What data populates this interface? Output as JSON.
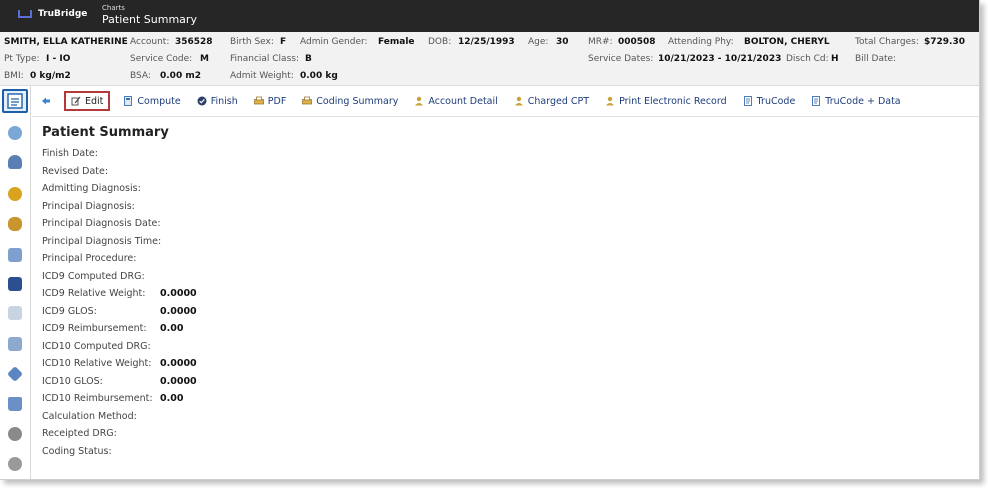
{
  "app": {
    "brand": "TruBridge",
    "breadcrumb_small": "Charts",
    "page_heading": "Patient Summary"
  },
  "patient": {
    "name": "SMITH, ELLA KATHERINE",
    "account_label": "Account:",
    "account": "356528",
    "birth_sex_label": "Birth Sex:",
    "birth_sex": "F",
    "admin_gender_label": "Admin Gender:",
    "admin_gender": "Female",
    "dob_label": "DOB:",
    "dob": "12/25/1993",
    "age_label": "Age:",
    "age": "30",
    "mrn_label": "MR#:",
    "mrn": "000508",
    "attending_label": "Attending Phy:",
    "attending": "BOLTON, CHERYL",
    "total_charges_label": "Total Charges:",
    "total_charges": "$729.30",
    "pt_type_label": "Pt Type:",
    "pt_type": "I - IO",
    "service_code_label": "Service Code:",
    "service_code": "M",
    "financial_class_label": "Financial Class:",
    "financial_class": "B",
    "service_dates_label": "Service Dates:",
    "service_dates": "10/21/2023 - 10/21/2023",
    "disch_cd_label": "Disch Cd:",
    "disch_cd": "H",
    "bill_date_label": "Bill Date:",
    "bill_date": "",
    "bmi_label": "BMI:",
    "bmi": "0 kg/m2",
    "bsa_label": "BSA:",
    "bsa": "0.00 m2",
    "admit_weight_label": "Admit Weight:",
    "admit_weight": "0.00 kg"
  },
  "sidebar": {
    "icons": [
      "charts-icon",
      "cloud-icon",
      "person-icon",
      "clock-icon",
      "people-icon",
      "document-icon",
      "book-icon",
      "note-icon",
      "file-icon",
      "tag-icon",
      "home-icon",
      "globe-icon",
      "settings-icon"
    ]
  },
  "toolbar": {
    "back": "",
    "edit": "Edit",
    "compute": "Compute",
    "finish": "Finish",
    "pdf": "PDF",
    "coding_summary": "Coding Summary",
    "account_detail": "Account Detail",
    "charged_cpt": "Charged CPT",
    "print_record": "Print Electronic Record",
    "trucode": "TruCode",
    "trucode_data": "TruCode + Data"
  },
  "summary": {
    "title": "Patient Summary",
    "fields": [
      {
        "label": "Finish Date:",
        "value": ""
      },
      {
        "label": "Revised Date:",
        "value": ""
      },
      {
        "label": "Admitting Diagnosis:",
        "value": ""
      },
      {
        "label": "Principal Diagnosis:",
        "value": ""
      },
      {
        "label": "Principal Diagnosis Date:",
        "value": ""
      },
      {
        "label": "Principal Diagnosis Time:",
        "value": ""
      },
      {
        "label": "Principal Procedure:",
        "value": ""
      },
      {
        "label": "ICD9 Computed DRG:",
        "value": ""
      },
      {
        "label": "ICD9 Relative Weight:",
        "value": "0.0000"
      },
      {
        "label": "ICD9 GLOS:",
        "value": "0.0000"
      },
      {
        "label": "ICD9 Reimbursement:",
        "value": "0.00"
      },
      {
        "label": "ICD10 Computed DRG:",
        "value": ""
      },
      {
        "label": "ICD10 Relative Weight:",
        "value": "0.0000"
      },
      {
        "label": "ICD10 GLOS:",
        "value": "0.0000"
      },
      {
        "label": "ICD10 Reimbursement:",
        "value": "0.00"
      },
      {
        "label": "Calculation Method:",
        "value": ""
      },
      {
        "label": "Receipted DRG:",
        "value": ""
      },
      {
        "label": "Coding Status:",
        "value": ""
      }
    ]
  },
  "colors": {
    "topbar": "#262626",
    "accent": "#1d5ea8",
    "edit_border": "#b33a3a",
    "link": "#1f3d7a"
  }
}
